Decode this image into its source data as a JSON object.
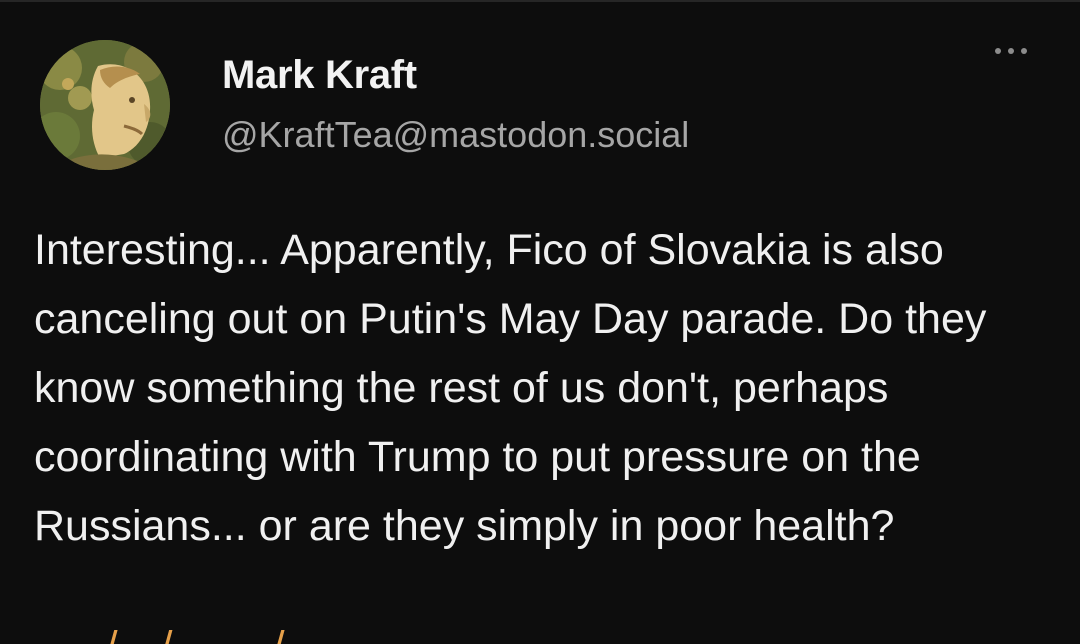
{
  "post": {
    "author": {
      "display_name": "Mark Kraft",
      "handle": "@KraftTea@mastodon.social",
      "avatar_icon": "profile-avatar"
    },
    "more_menu_icon": "more-horizontal-icon",
    "text": "Interesting... Apparently, Fico of Slovakia is also canceling out on Putin's May Day parade. Do they know something the rest of us don't, perhaps coordinating with Trump to put pressure on the Russians... or are they simply in poor health?",
    "link_partial": "·····/···/·······/····· ·· ·· ·· ··· ·"
  },
  "colors": {
    "background": "#0d0d0d",
    "text": "#f0f0f0",
    "muted": "#a6a6a6",
    "link": "#e6a04a"
  }
}
